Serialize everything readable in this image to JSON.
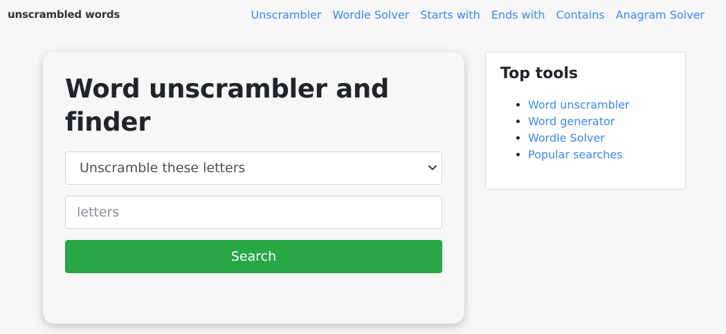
{
  "brand": "unscrambled words",
  "nav": {
    "links": [
      "Unscrambler",
      "Wordle Solver",
      "Starts with",
      "Ends with",
      "Contains",
      "Anagram Solver"
    ]
  },
  "main": {
    "title": "Word unscrambler and finder",
    "select_value": "Unscramble these letters",
    "input_placeholder": "letters",
    "search_label": "Search"
  },
  "sidebar": {
    "title": "Top tools",
    "items": [
      "Word unscrambler",
      "Word generator",
      "Wordle Solver",
      "Popular searches"
    ]
  },
  "colors": {
    "link": "#3a86ff",
    "button": "#28a745",
    "background": "#f7f7f7"
  },
  "icons": {
    "select_chevron": "chevron-down-icon"
  }
}
